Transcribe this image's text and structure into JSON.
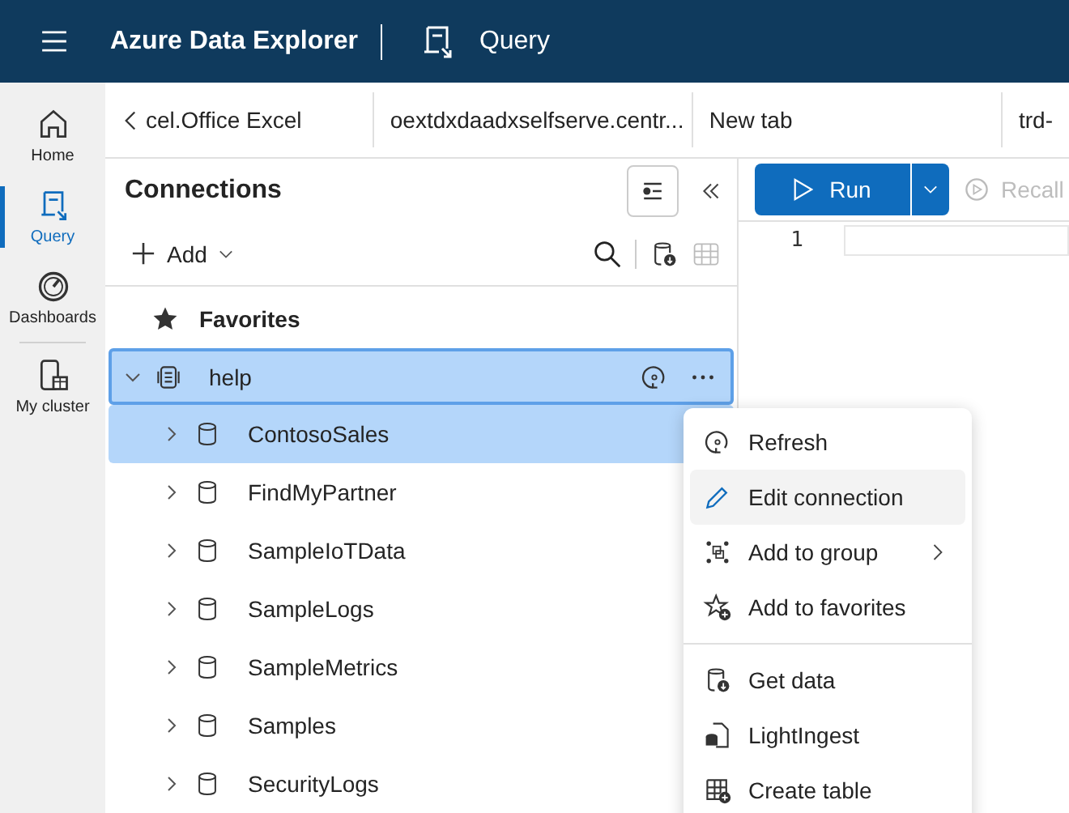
{
  "header": {
    "app_title": "Azure Data Explorer",
    "section_title": "Query"
  },
  "nav": [
    {
      "label": "Home",
      "kind": "home",
      "selected": false
    },
    {
      "label": "Query",
      "kind": "query",
      "selected": true
    },
    {
      "label": "Dashboards",
      "kind": "dashboards",
      "selected": false
    },
    {
      "label": "My cluster",
      "kind": "cluster",
      "selected": false
    }
  ],
  "tabs": [
    {
      "label": "cel.Office Excel"
    },
    {
      "label": "oextdxdaadxselfserve.centr..."
    },
    {
      "label": "New tab"
    },
    {
      "label": "trd-"
    }
  ],
  "connections": {
    "title": "Connections",
    "add_label": "Add",
    "favorites": "Favorites",
    "cluster": {
      "name": "help",
      "expanded": true,
      "selected": true,
      "children": [
        {
          "name": "ContosoSales",
          "selected": true
        },
        {
          "name": "FindMyPartner",
          "selected": false
        },
        {
          "name": "SampleIoTData",
          "selected": false
        },
        {
          "name": "SampleLogs",
          "selected": false
        },
        {
          "name": "SampleMetrics",
          "selected": false
        },
        {
          "name": "Samples",
          "selected": false
        },
        {
          "name": "SecurityLogs",
          "selected": false
        }
      ]
    }
  },
  "context_menu": {
    "groups": [
      [
        {
          "label": "Refresh",
          "kind": "refresh",
          "highlighted": false,
          "submenu": false
        },
        {
          "label": "Edit connection",
          "kind": "edit",
          "highlighted": true,
          "submenu": false
        },
        {
          "label": "Add to group",
          "kind": "group",
          "highlighted": false,
          "submenu": true
        },
        {
          "label": "Add to favorites",
          "kind": "favorite",
          "highlighted": false,
          "submenu": false
        }
      ],
      [
        {
          "label": "Get data",
          "kind": "getdata",
          "highlighted": false,
          "submenu": false
        },
        {
          "label": "LightIngest",
          "kind": "ingest",
          "highlighted": false,
          "submenu": false
        },
        {
          "label": "Create table",
          "kind": "table",
          "highlighted": false,
          "submenu": false
        }
      ]
    ]
  },
  "editor": {
    "run_label": "Run",
    "recall_label": "Recall",
    "line_numbers": [
      "1"
    ]
  }
}
